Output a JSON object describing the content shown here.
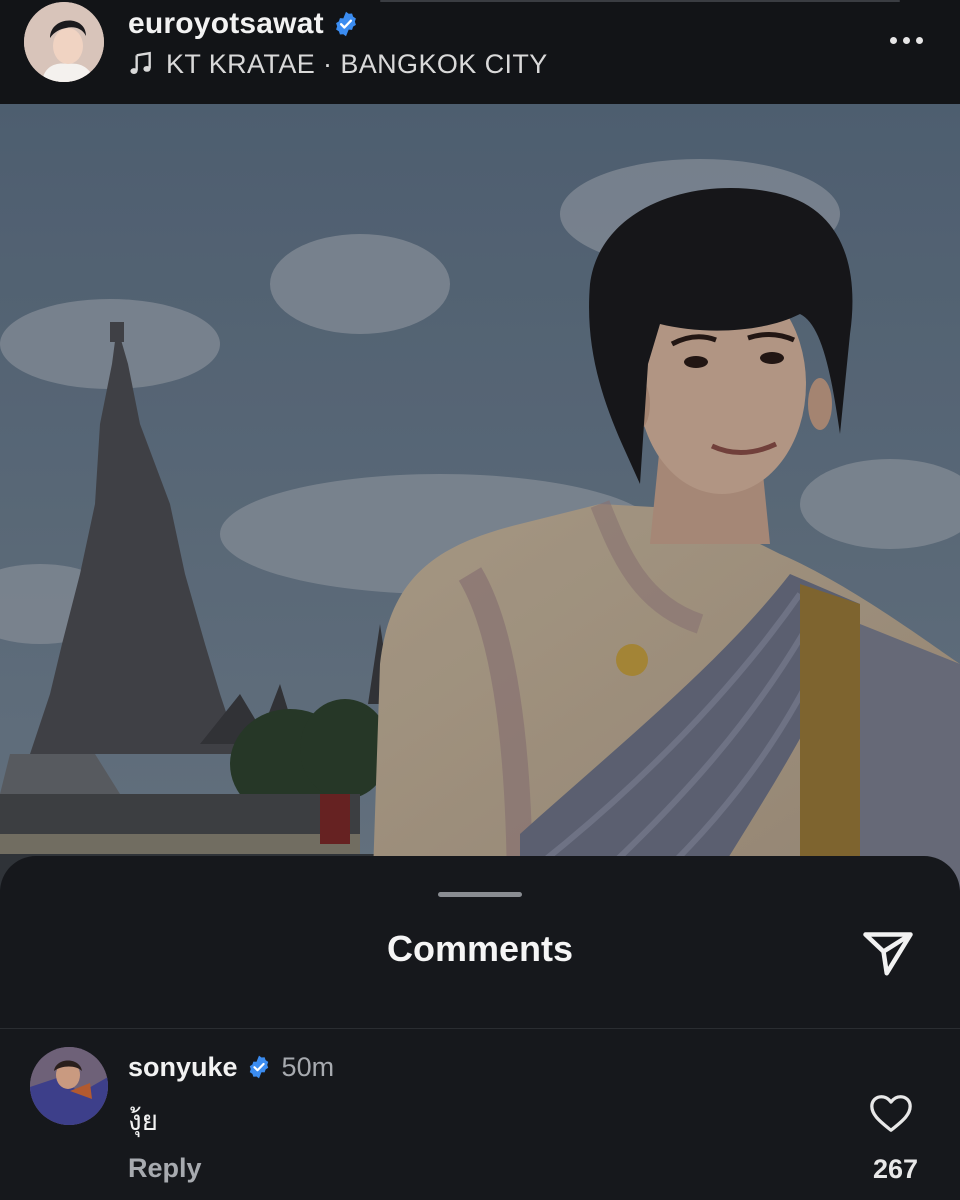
{
  "header": {
    "username": "euroyotsawat",
    "verified": true,
    "music_icon": "music-note-icon",
    "subtitle": "KT KRATAE · BANGKOK CITY",
    "more_icon": "more-horizontal-icon"
  },
  "post": {
    "image_icon": "post-photo"
  },
  "comments_sheet": {
    "title": "Comments",
    "send_icon": "send-icon",
    "comments": [
      {
        "user": "sonyuke",
        "verified": true,
        "time": "50m",
        "text": "งุ้ย",
        "reply_label": "Reply",
        "like_icon": "heart-icon",
        "likes": "267"
      }
    ]
  },
  "colors": {
    "background": "#16181c",
    "header_bg": "#121417",
    "verified_blue": "#3b8cf0",
    "muted_text": "#a7aaaf"
  }
}
